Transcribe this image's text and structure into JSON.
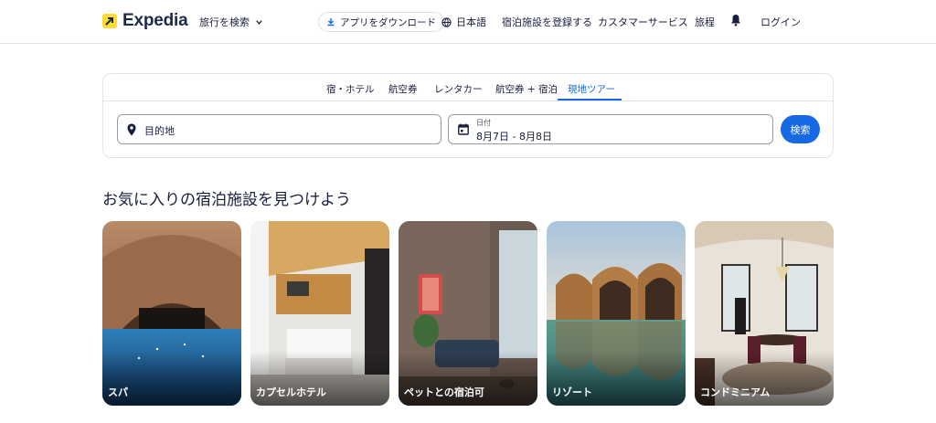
{
  "header": {
    "brand": "Expedia",
    "trip_search": "旅行を検索",
    "app_download": "アプリをダウンロード",
    "language": "日本語",
    "list_property": "宿泊施設を登録する",
    "customer_service": "カスタマーサービス",
    "trips": "旅程",
    "login": "ログイン"
  },
  "search": {
    "tabs": [
      {
        "label": "宿・ホテル"
      },
      {
        "label": "航空券"
      },
      {
        "label": "レンタカー"
      },
      {
        "label": "航空券 + 宿泊"
      },
      {
        "label": "現地ツアー",
        "active": true
      }
    ],
    "destination_placeholder": "目的地",
    "date_label": "日付",
    "date_value": "8月7日 - 8月8日",
    "search_button": "検索"
  },
  "section": {
    "title": "お気に入りの宿泊施設を見つけよう",
    "tiles": [
      {
        "label": "スパ",
        "image": "spa-image"
      },
      {
        "label": "カプセルホテル",
        "image": "capsule-hotel-image"
      },
      {
        "label": "ペットとの宿泊可",
        "image": "pet-friendly-image"
      },
      {
        "label": "リゾート",
        "image": "resort-image"
      },
      {
        "label": "コンドミニアム",
        "image": "condominium-image"
      }
    ]
  },
  "colors": {
    "accent": "#1668e3",
    "brand_yellow": "#fddb32",
    "text": "#191e3b"
  }
}
